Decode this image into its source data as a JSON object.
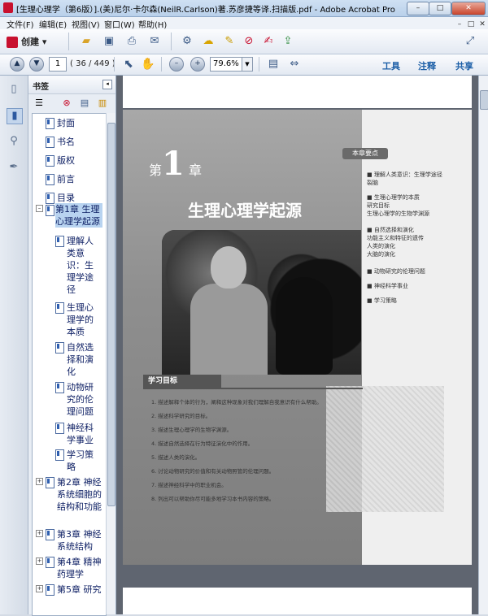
{
  "window": {
    "title": "[生理心理学（第6版）].(美)尼尔·卡尔森(NeilR.Carlson)著.苏彦捷等译.扫描版.pdf - Adobe Acrobat Pro",
    "min": "–",
    "max": "□",
    "close": "✕"
  },
  "menu": {
    "items": [
      "文件(F)",
      "编辑(E)",
      "视图(V)",
      "窗口(W)",
      "帮助(H)"
    ],
    "right": [
      "–",
      "□",
      "✕"
    ]
  },
  "toolbar": {
    "create_label": "创建",
    "create_arrow": "▾",
    "icons": [
      "folder-open-icon",
      "save-icon",
      "print-icon",
      "email-icon",
      "settings-icon",
      "comment-icon",
      "highlight-icon",
      "convert-icon",
      "sign-icon",
      "share-icon"
    ],
    "expand_icon": "⤢"
  },
  "navbar": {
    "page_current": "1",
    "page_count": "( 36 / 449 )",
    "zoom": "79.6%",
    "tools": "工具",
    "comment": "注释",
    "share": "共享"
  },
  "bookmarks": {
    "title": "书签",
    "items": [
      {
        "label": "封面"
      },
      {
        "label": "书名"
      },
      {
        "label": "版权"
      },
      {
        "label": "前言"
      },
      {
        "label": "目录"
      },
      {
        "label": "第1章 生理心理学起源"
      },
      {
        "label": "理解人类意识：生理学途径"
      },
      {
        "label": "生理心理学的本质"
      },
      {
        "label": "自然选择和演化"
      },
      {
        "label": "动物研究的伦理问题"
      },
      {
        "label": "神经科学事业"
      },
      {
        "label": "学习策略"
      },
      {
        "label": "第2章 神经系统细胞的结构和功能"
      },
      {
        "label": "第3章 神经系统结构"
      },
      {
        "label": "第4章 精神药理学"
      },
      {
        "label": "第5章 研究"
      }
    ]
  },
  "page": {
    "chapter_prefix": "第",
    "chapter_num": "1",
    "chapter_suffix": "章",
    "chapter_title": "生理心理学起源",
    "key_tag": "本章要点",
    "key_points": [
      "■ 理解人类意识：生理学途径",
      "   裂脑",
      "■ 生理心理学的本质",
      "   研究目标",
      "   生理心理学的生物学渊源",
      "■ 自然选择和演化",
      "   功能主义和特征的遗传",
      "   人类的演化",
      "   大脑的演化",
      "■ 动物研究的伦理问题",
      "■ 神经科学事业",
      "■ 学习策略"
    ],
    "goal_title": "学习目标",
    "goals": [
      "1. 描述解释个体的行为，阐释这种现象对我们理解自我意识有什么帮助。",
      "2. 描述科学研究的目标。",
      "3. 描述生理心理学的生物学渊源。",
      "4. 描述自然选择在行为特征演化中的作用。",
      "5. 描述人类的演化。",
      "6. 讨论动物研究的价值和有关动物照管的伦理问题。",
      "7. 描述神经科学中的职业机会。",
      "8. 列出可以帮助你尽可能多地学习本书内容的策略。"
    ]
  }
}
